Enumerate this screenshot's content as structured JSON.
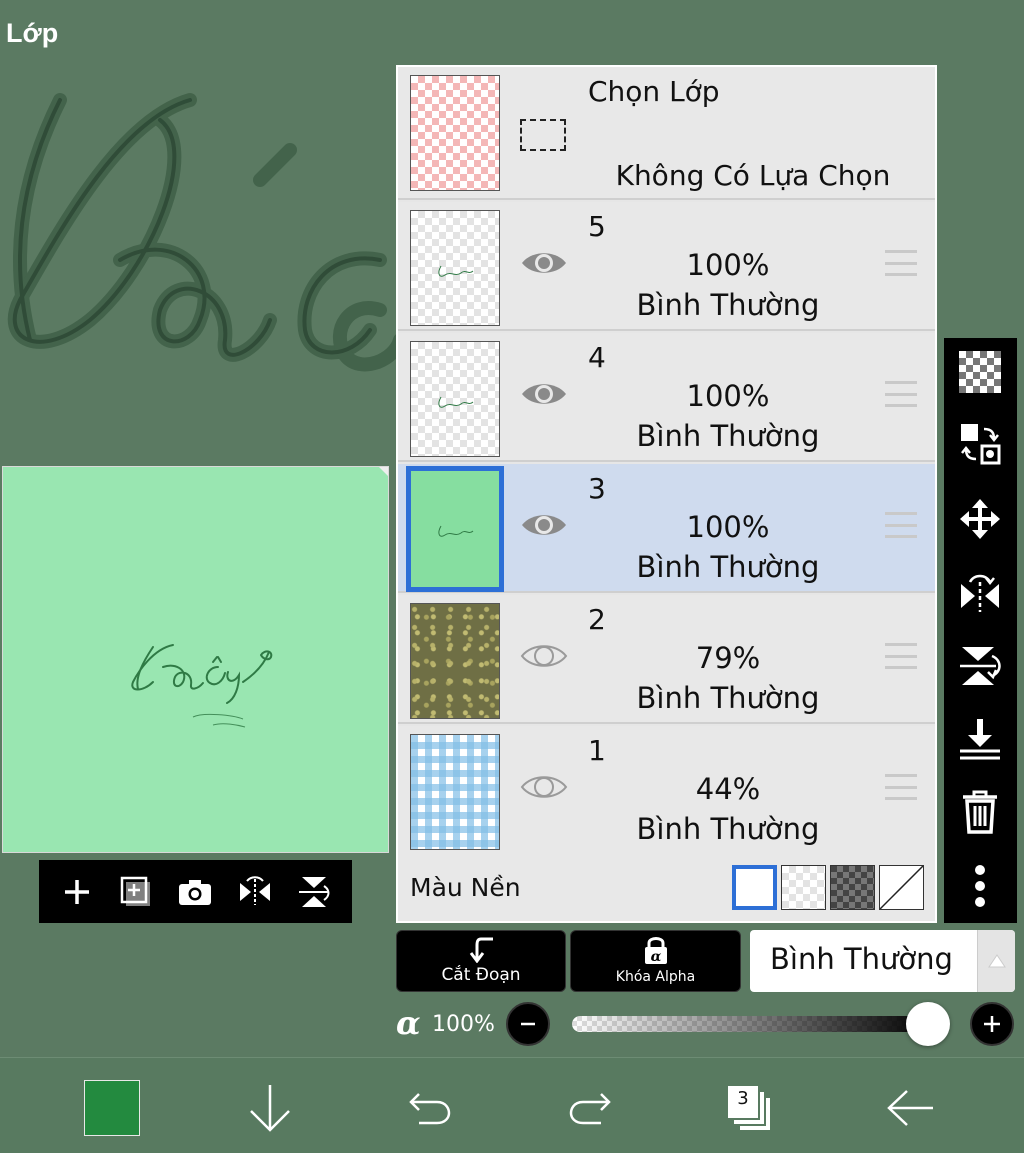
{
  "header": {
    "title": "Lớp"
  },
  "selection_layer": {
    "title": "Chọn Lớp",
    "status": "Không Có Lựa Chọn"
  },
  "layers": [
    {
      "number": "5",
      "opacity": "100%",
      "mode": "Bình Thường",
      "visible": true,
      "selected": false,
      "thumb": "checker-script"
    },
    {
      "number": "4",
      "opacity": "100%",
      "mode": "Bình Thường",
      "visible": true,
      "selected": false,
      "thumb": "checker-script"
    },
    {
      "number": "3",
      "opacity": "100%",
      "mode": "Bình Thường",
      "visible": true,
      "selected": true,
      "thumb": "green"
    },
    {
      "number": "2",
      "opacity": "79%",
      "mode": "Bình Thường",
      "visible": false,
      "selected": false,
      "thumb": "olive-pattern"
    },
    {
      "number": "1",
      "opacity": "44%",
      "mode": "Bình Thường",
      "visible": false,
      "selected": false,
      "thumb": "blue-gingham"
    }
  ],
  "background_color": {
    "label": "Màu Nền",
    "options": [
      "white",
      "checker-light",
      "checker-dark",
      "none"
    ],
    "selected": "white"
  },
  "canvas_toolbar": [
    "add-layer-icon",
    "duplicate-layer-icon",
    "camera-icon",
    "flip-horizontal-icon",
    "flip-vertical-icon"
  ],
  "right_toolbar": [
    "transparency-icon",
    "swap-layers-icon",
    "move-icon",
    "flip-horizontal-icon",
    "flip-vertical-icon",
    "merge-down-icon",
    "trash-icon",
    "more-icon"
  ],
  "blend": {
    "clipping_label": "Cắt Đoạn",
    "alpha_lock_label": "Khóa Alpha",
    "mode_value": "Bình Thường"
  },
  "alpha": {
    "symbol": "α",
    "value": "100%",
    "level": 1.0
  },
  "bottom_bar": {
    "current_color": "#238a3f",
    "layer_count": "3"
  },
  "colors": {
    "app_background": "#5b7a62",
    "canvas_fill": "#99e6b1",
    "selection_highlight": "#cfdbee",
    "accent_blue": "#2d6fd6"
  }
}
